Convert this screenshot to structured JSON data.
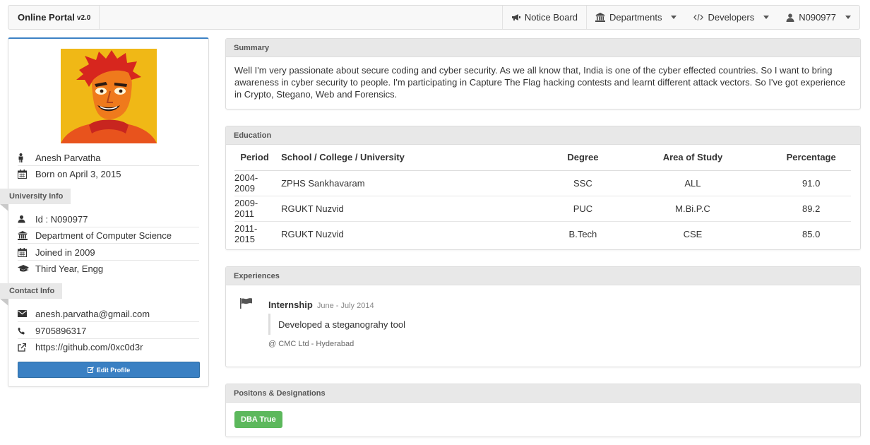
{
  "navbar": {
    "brand": "Online Portal",
    "version": "v2.0",
    "notice_board": "Notice Board",
    "departments": "Departments",
    "developers": "Developers",
    "user": "N090977"
  },
  "profile": {
    "name": "Anesh Parvatha",
    "born": "Born on April 3, 2015",
    "university_header": "University Info",
    "id": "Id : N090977",
    "department": "Department of Computer Science",
    "joined": "Joined in 2009",
    "year": "Third Year, Engg",
    "contact_header": "Contact Info",
    "email": "anesh.parvatha@gmail.com",
    "phone": "9705896317",
    "github": "https://github.com/0xc0d3r",
    "edit_label": "Edit Profile"
  },
  "summary": {
    "title": "Summary",
    "text": "Well I'm very passionate about secure coding and cyber security. As we all know that, India is one of the cyber effected countries. So I want to bring awareness in cyber security to people. I'm participating in Capture The Flag hacking contests and learnt different attack vectors. So I've got experience in Crypto, Stegano, Web and Forensics."
  },
  "education": {
    "title": "Education",
    "columns": [
      "Period",
      "School / College / University",
      "Degree",
      "Area of Study",
      "Percentage"
    ],
    "rows": [
      [
        "2004-2009",
        "ZPHS Sankhavaram",
        "SSC",
        "ALL",
        "91.0"
      ],
      [
        "2009-2011",
        "RGUKT Nuzvid",
        "PUC",
        "M.Bi.P.C",
        "89.2"
      ],
      [
        "2011-2015",
        "RGUKT Nuzvid",
        "B.Tech",
        "CSE",
        "85.0"
      ]
    ]
  },
  "experiences": {
    "title": "Experiences",
    "items": [
      {
        "role": "Internship",
        "date": "June - July 2014",
        "description": "Developed a steganograhy tool",
        "where": "@ CMC Ltd - Hyderabad"
      }
    ]
  },
  "positions": {
    "title": "Positons & Designations",
    "badges": [
      "DBA True"
    ]
  },
  "colors": {
    "primary": "#3a80c3",
    "success": "#5cb85c",
    "panel_header": "#e8e8e8"
  }
}
